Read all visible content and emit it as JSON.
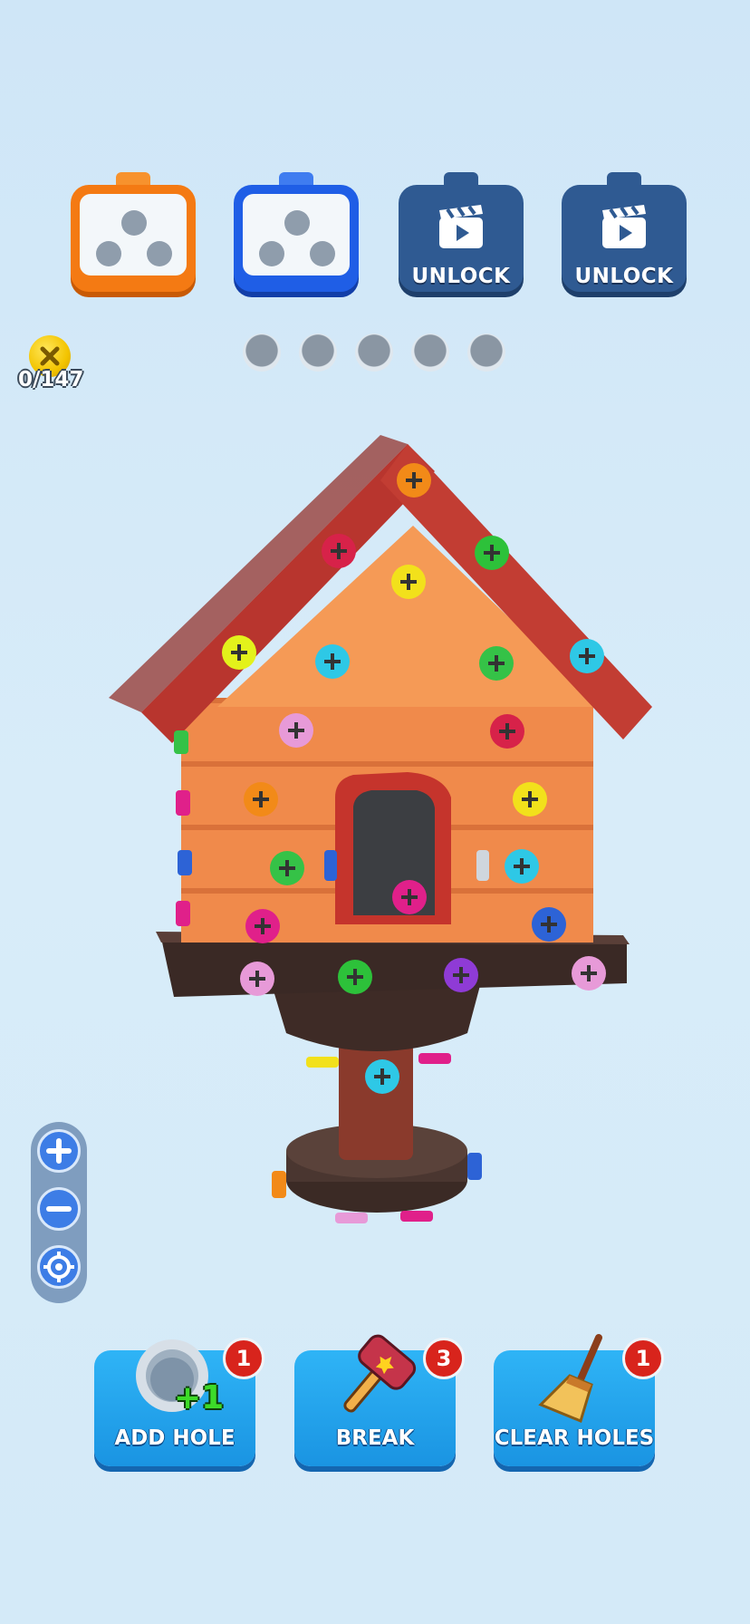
{
  "slots": [
    {
      "state": "orange",
      "holes": 3
    },
    {
      "state": "blue",
      "holes": 3
    },
    {
      "state": "locked",
      "label": "UNLOCK",
      "icon": "video-clapper-icon"
    },
    {
      "state": "locked",
      "label": "UNLOCK",
      "icon": "video-clapper-icon"
    }
  ],
  "queue_dots": 5,
  "counter": {
    "icon": "screw-coin-icon",
    "text": "0/147"
  },
  "zoom": {
    "in_icon": "plus-icon",
    "out_icon": "minus-icon",
    "recenter_icon": "target-icon"
  },
  "boosters": [
    {
      "label": "ADD HOLE",
      "badge": "1",
      "icon": "add-hole-icon",
      "bonus": "+1"
    },
    {
      "label": "BREAK",
      "badge": "3",
      "icon": "hammer-icon"
    },
    {
      "label": "CLEAR HOLES",
      "badge": "1",
      "icon": "broom-icon"
    }
  ],
  "colors": {
    "background": "#d4eaf8",
    "orange_box": "#f47a13",
    "blue_box": "#1f5ee6",
    "locked_box": "#2f5a92",
    "booster": "#1a94e2",
    "badge": "#d8241c"
  }
}
